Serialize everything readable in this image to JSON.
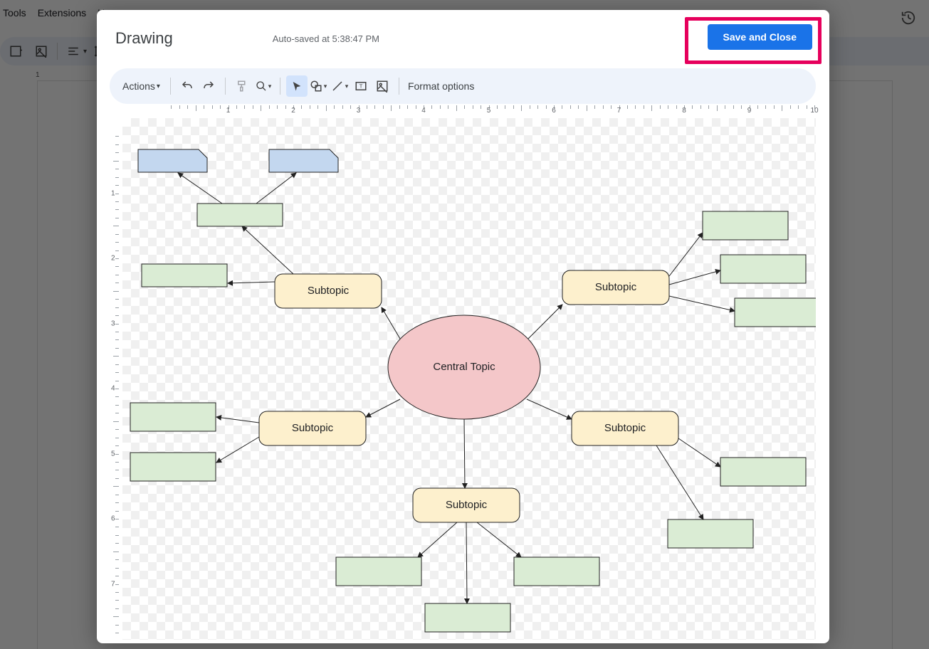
{
  "bgMenu": {
    "item1": "Tools",
    "item2": "Extensions",
    "item3": "H"
  },
  "bgRulerNum": "1",
  "dialog": {
    "title": "Drawing",
    "autosave": "Auto-saved at 5:38:47 PM",
    "saveClose": "Save and Close"
  },
  "toolbar": {
    "actions": "Actions",
    "formatOptions": "Format options"
  },
  "hRuler": [
    "1",
    "2",
    "3",
    "4",
    "5",
    "6",
    "7",
    "8",
    "9",
    "10"
  ],
  "vRuler": [
    "1",
    "2",
    "3",
    "4",
    "5",
    "6",
    "7"
  ],
  "shapes": {
    "central": "Central Topic",
    "sub1": "Subtopic",
    "sub2": "Subtopic",
    "sub3": "Subtopic",
    "sub4": "Subtopic",
    "sub5": "Subtopic"
  },
  "colors": {
    "pink": "#f4c7c9",
    "yellow": "#fdf0cd",
    "green": "#daecd4",
    "blue": "#c3d7ef",
    "stroke": "#212121"
  }
}
